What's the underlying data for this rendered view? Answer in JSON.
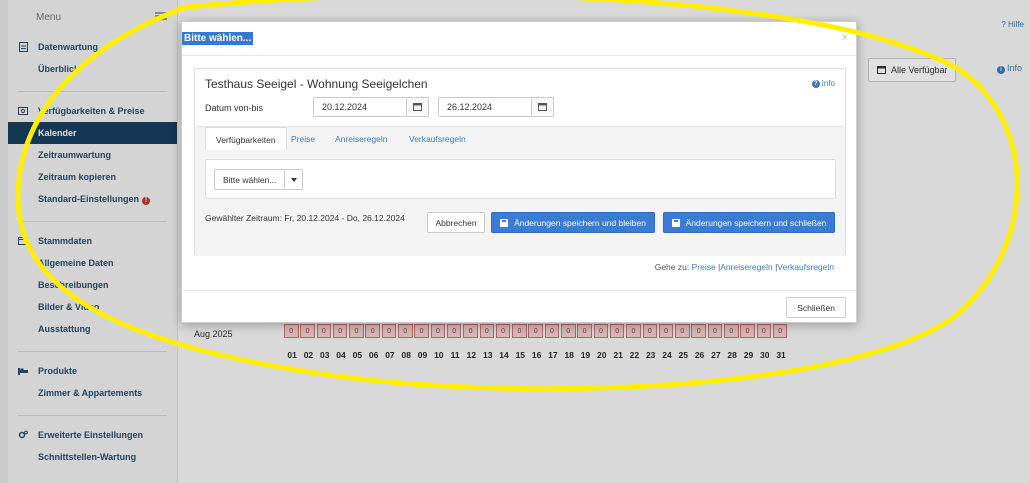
{
  "sidebar": {
    "menu_label": "Menu",
    "sections": [
      {
        "title": "Datenwartung",
        "icon": "document-icon",
        "items": [
          {
            "label": "Überblick"
          }
        ]
      },
      {
        "title": "Verfügbarkeiten & Preise",
        "icon": "euro-icon",
        "items": [
          {
            "label": "Kalender",
            "active": true
          },
          {
            "label": "Zeitraumwartung"
          },
          {
            "label": "Zeitraum kopieren"
          },
          {
            "label": "Standard-Einstellungen",
            "warning": true
          }
        ]
      },
      {
        "title": "Stammdaten",
        "icon": "card-icon",
        "items": [
          {
            "label": "Allgemeine Daten"
          },
          {
            "label": "Beschreibungen"
          },
          {
            "label": "Bilder & Video"
          },
          {
            "label": "Ausstattung"
          }
        ]
      },
      {
        "title": "Produkte",
        "icon": "bed-icon",
        "items": [
          {
            "label": "Zimmer & Appartements"
          }
        ]
      },
      {
        "title": "Erweiterte Einstellungen",
        "icon": "cogs-icon",
        "items": [
          {
            "label": "Schnittstellen-Wartung"
          }
        ]
      }
    ]
  },
  "header": {
    "help_label": "? Hilfe",
    "all_availabilities_label": "Alle Verfügbarkeiten",
    "info_label": "Info"
  },
  "calendar": {
    "month_label": "Aug 2025",
    "cell_value": "0",
    "days": [
      "01",
      "02",
      "03",
      "04",
      "05",
      "06",
      "07",
      "08",
      "09",
      "10",
      "11",
      "12",
      "13",
      "14",
      "15",
      "16",
      "17",
      "18",
      "19",
      "20",
      "21",
      "22",
      "23",
      "24",
      "25",
      "26",
      "27",
      "28",
      "29",
      "30",
      "31"
    ]
  },
  "modal": {
    "title": "Bitte wählen...",
    "close_glyph": "×",
    "property_title": "Testhaus Seeigel - Wohnung Seeigelchen",
    "info_label": "Info",
    "date_range_label": "Datum von-bis",
    "date_from": "20.12.2024",
    "date_to": "26.12.2024",
    "tabs": [
      "Verfügbarkeiten",
      "Preise",
      "Anreiseregeln",
      "Verkaufsregeln"
    ],
    "select_label": "Bitte wählen...",
    "selected_range": "Gewählter Zeitraum: Fr, 20.12.2024 - Do, 26.12.2024",
    "cancel_label": "Abbrechen",
    "save_stay_label": "Änderungen speichern und bleiben",
    "save_close_label": "Änderungen speichern und schließen",
    "goto_prefix": "Gehe zu:",
    "goto_links": [
      "Preise",
      "Anreiseregeln",
      "Verkaufsregeln"
    ],
    "close_label": "Schließen"
  },
  "colors": {
    "highlight_ellipse": "#ffee00",
    "primary": "#3a7bd5",
    "sidebar_active": "#173f5f"
  }
}
